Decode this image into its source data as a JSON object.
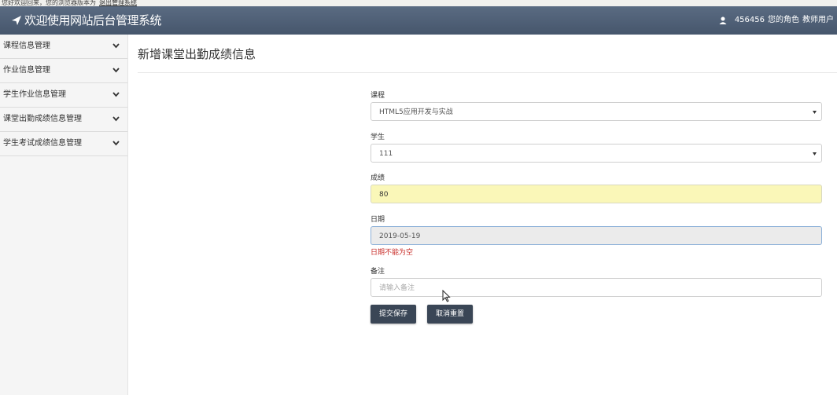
{
  "top_strip": {
    "text": "您好欢迎回来，您的浏览器版本为",
    "link": "退出管理系统"
  },
  "header": {
    "title": "欢迎使用网站后台管理系统",
    "username": "456456",
    "role_label": "您的角色",
    "role": "教师用户"
  },
  "sidebar": {
    "items": [
      {
        "label": "课程信息管理"
      },
      {
        "label": "作业信息管理"
      },
      {
        "label": "学生作业信息管理"
      },
      {
        "label": "课堂出勤成绩信息管理"
      },
      {
        "label": "学生考试成绩信息管理"
      }
    ]
  },
  "page": {
    "title": "新增课堂出勤成绩信息"
  },
  "form": {
    "course_label": "课程",
    "course_value": "HTML5应用开发与实战",
    "student_label": "学生",
    "student_value": "111",
    "score_label": "成绩",
    "score_value": "80",
    "date_label": "日期",
    "date_value": "2019-05-19",
    "date_error": "日期不能为空",
    "remark_label": "备注",
    "remark_placeholder": "请输入备注",
    "submit_label": "提交保存",
    "reset_label": "取消重置"
  },
  "colors": {
    "header_bg": "#4d5d74",
    "button_bg": "#3a4656",
    "error": "#c9302c",
    "score_bg": "#faf7b8"
  }
}
